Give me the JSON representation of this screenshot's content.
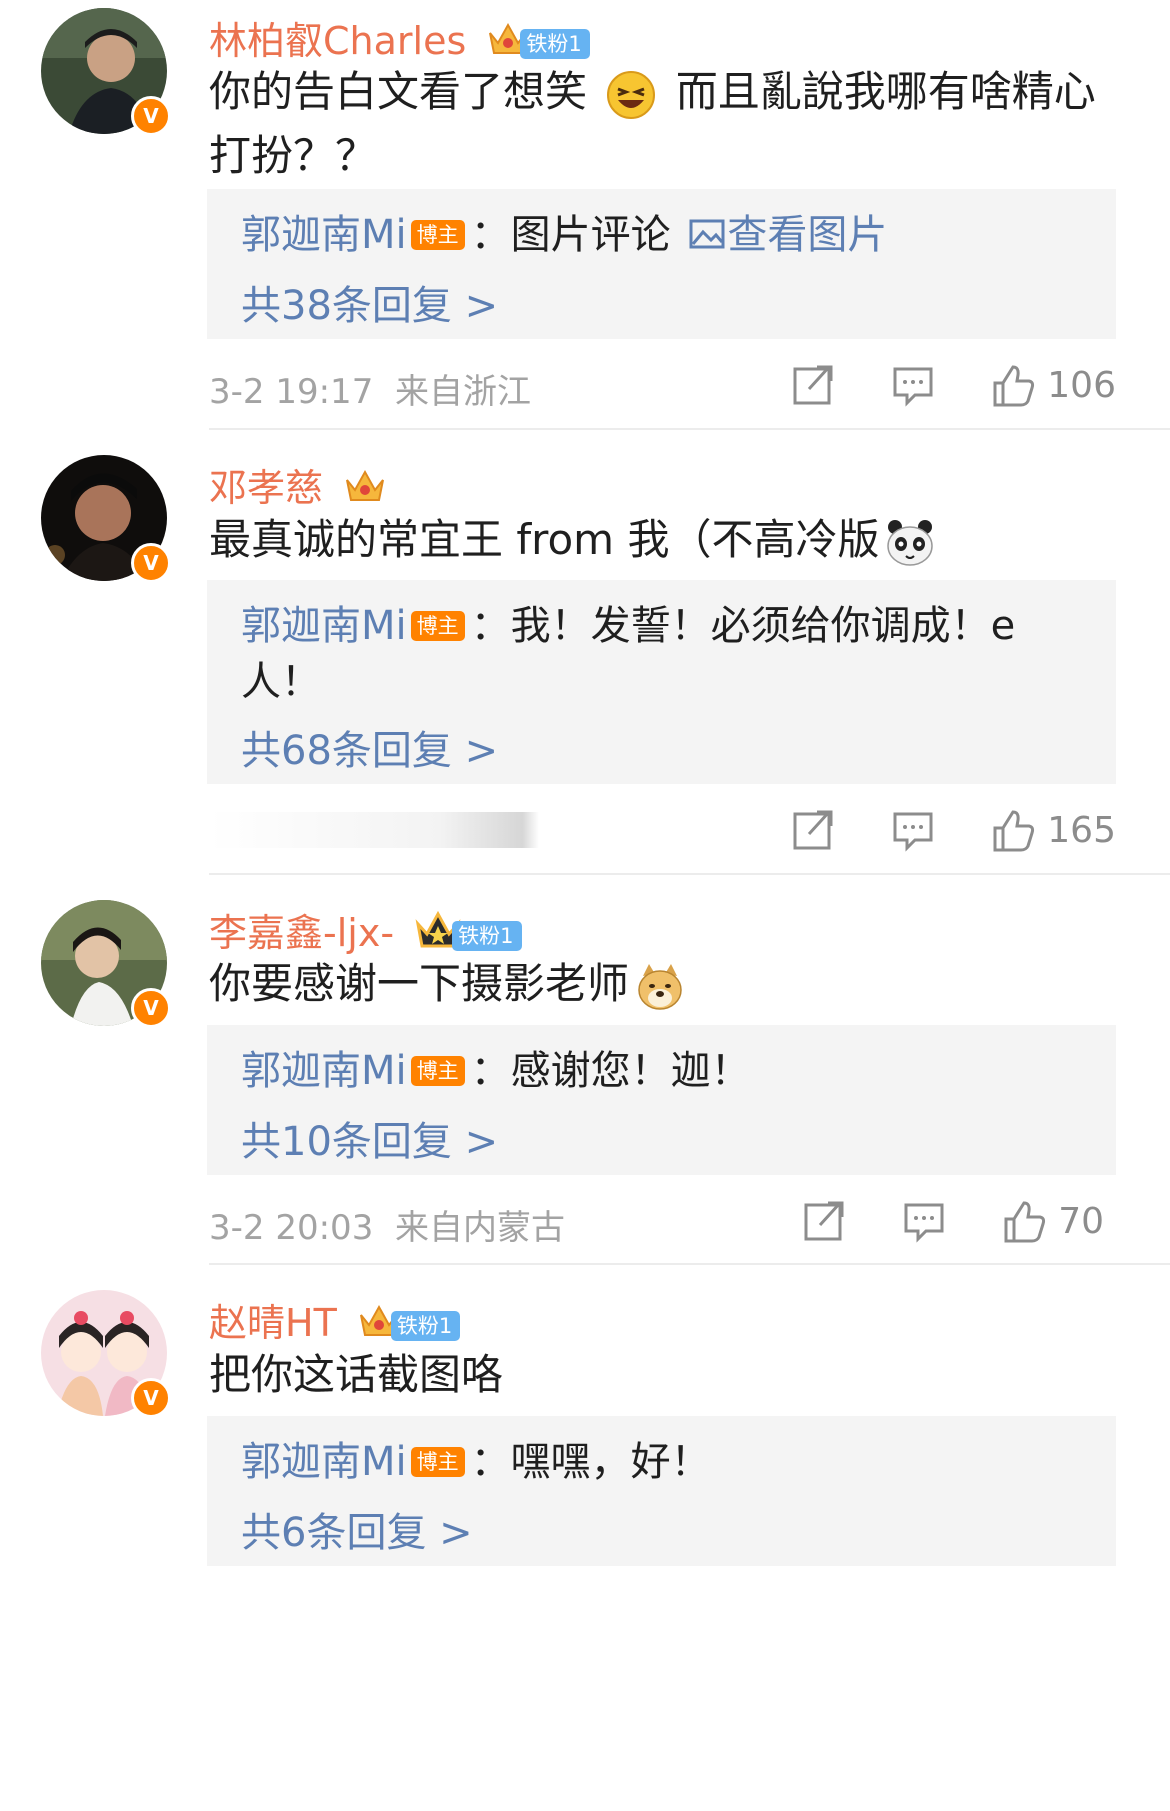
{
  "comments": [
    {
      "username": "林柏叡Charles",
      "fan_badge": "铁粉1",
      "text_before_emoji": "你的告白文看了想笑",
      "text_after_emoji": " 而且亂說我哪有啥精心打扮？？",
      "emoji": "laughing-emoji",
      "reply_author": "郭迦南Mi",
      "boss_label": "博主",
      "reply_text": "：图片评论",
      "reply_link": "查看图片",
      "total_replies": "共38条回复 >",
      "time": "3-2 19:17",
      "location": "来自浙江",
      "likes": "106"
    },
    {
      "username": "邓孝慈",
      "text_before_emoji": "最真诚的常宜王 from 我（不高冷版",
      "emoji": "panda-emoji",
      "reply_author": "郭迦南Mi",
      "boss_label": "博主",
      "reply_text": "：我！发誓！必须给你调成！e人！",
      "total_replies": "共68条回复 >",
      "likes": "165"
    },
    {
      "username": "李嘉鑫-ljx-",
      "fan_badge": "铁粉1",
      "text_before_emoji": "你要感谢一下摄影老师",
      "emoji": "doge-emoji",
      "reply_author": "郭迦南Mi",
      "boss_label": "博主",
      "reply_text": "：感谢您！迦！",
      "total_replies": "共10条回复 >",
      "time": "3-2 20:03",
      "location": "来自内蒙古",
      "likes": "70"
    },
    {
      "username": "赵晴HT",
      "fan_badge": "铁粉1",
      "text_before_emoji": "把你这话截图咯",
      "reply_author": "郭迦南Mi",
      "boss_label": "博主",
      "reply_text": "：嘿嘿，好！",
      "total_replies": "共6条回复 >"
    }
  ],
  "colors": {
    "username": "#eb7350",
    "link": "#5d7fb3",
    "meta": "#a3a3a3",
    "reply_bg": "#f4f4f4",
    "verified": "#ff8200",
    "fan_badge": "#66b3f2"
  }
}
